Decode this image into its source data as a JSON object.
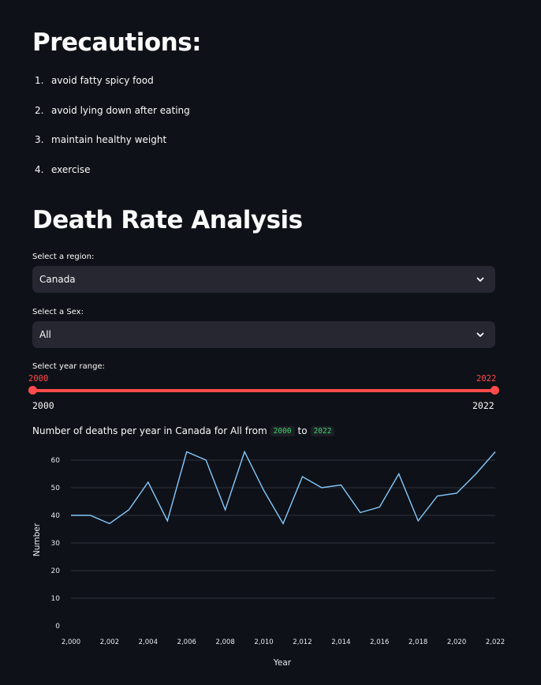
{
  "precautions": {
    "title": "Precautions:",
    "items": [
      {
        "num": "1.",
        "text": "avoid fatty spicy food"
      },
      {
        "num": "2.",
        "text": "avoid lying down after eating"
      },
      {
        "num": "3.",
        "text": "maintain healthy weight"
      },
      {
        "num": "4.",
        "text": "exercise"
      }
    ]
  },
  "analysis": {
    "title": "Death Rate Analysis",
    "region_label": "Select a region:",
    "region_value": "Canada",
    "sex_label": "Select a Sex:",
    "sex_value": "All",
    "year_label": "Select year range:",
    "year_start": "2000",
    "year_end": "2022",
    "year_min": "2000",
    "year_max": "2022",
    "caption_prefix": "Number of deaths per year in Canada for All from",
    "caption_from": "2000",
    "caption_to": "to",
    "caption_end": "2022"
  },
  "colors": {
    "background": "#0e1117",
    "accent": "#ff4b4b",
    "widget_bg": "#262730",
    "line": "#83c9ff",
    "code_text": "#3dd56d"
  },
  "icons": {
    "select_chevron": "chevron-down-icon"
  },
  "chart_data": {
    "type": "line",
    "title": "",
    "xlabel": "Year",
    "ylabel": "Number",
    "x": [
      2000,
      2001,
      2002,
      2003,
      2004,
      2005,
      2006,
      2007,
      2008,
      2009,
      2010,
      2011,
      2012,
      2013,
      2014,
      2015,
      2016,
      2017,
      2018,
      2019,
      2020,
      2021,
      2022
    ],
    "values": [
      40,
      40,
      37,
      42,
      52,
      38,
      63,
      60,
      42,
      63,
      49,
      37,
      54,
      50,
      51,
      41,
      43,
      55,
      38,
      47,
      48,
      55,
      63
    ],
    "xticks": [
      "2,000",
      "2,002",
      "2,004",
      "2,006",
      "2,008",
      "2,010",
      "2,012",
      "2,014",
      "2,016",
      "2,018",
      "2,020",
      "2,022"
    ],
    "yticks": [
      "0",
      "10",
      "20",
      "30",
      "40",
      "50",
      "60"
    ],
    "xlim": [
      2000,
      2022
    ],
    "ylim": [
      0,
      66
    ],
    "grid": true
  }
}
